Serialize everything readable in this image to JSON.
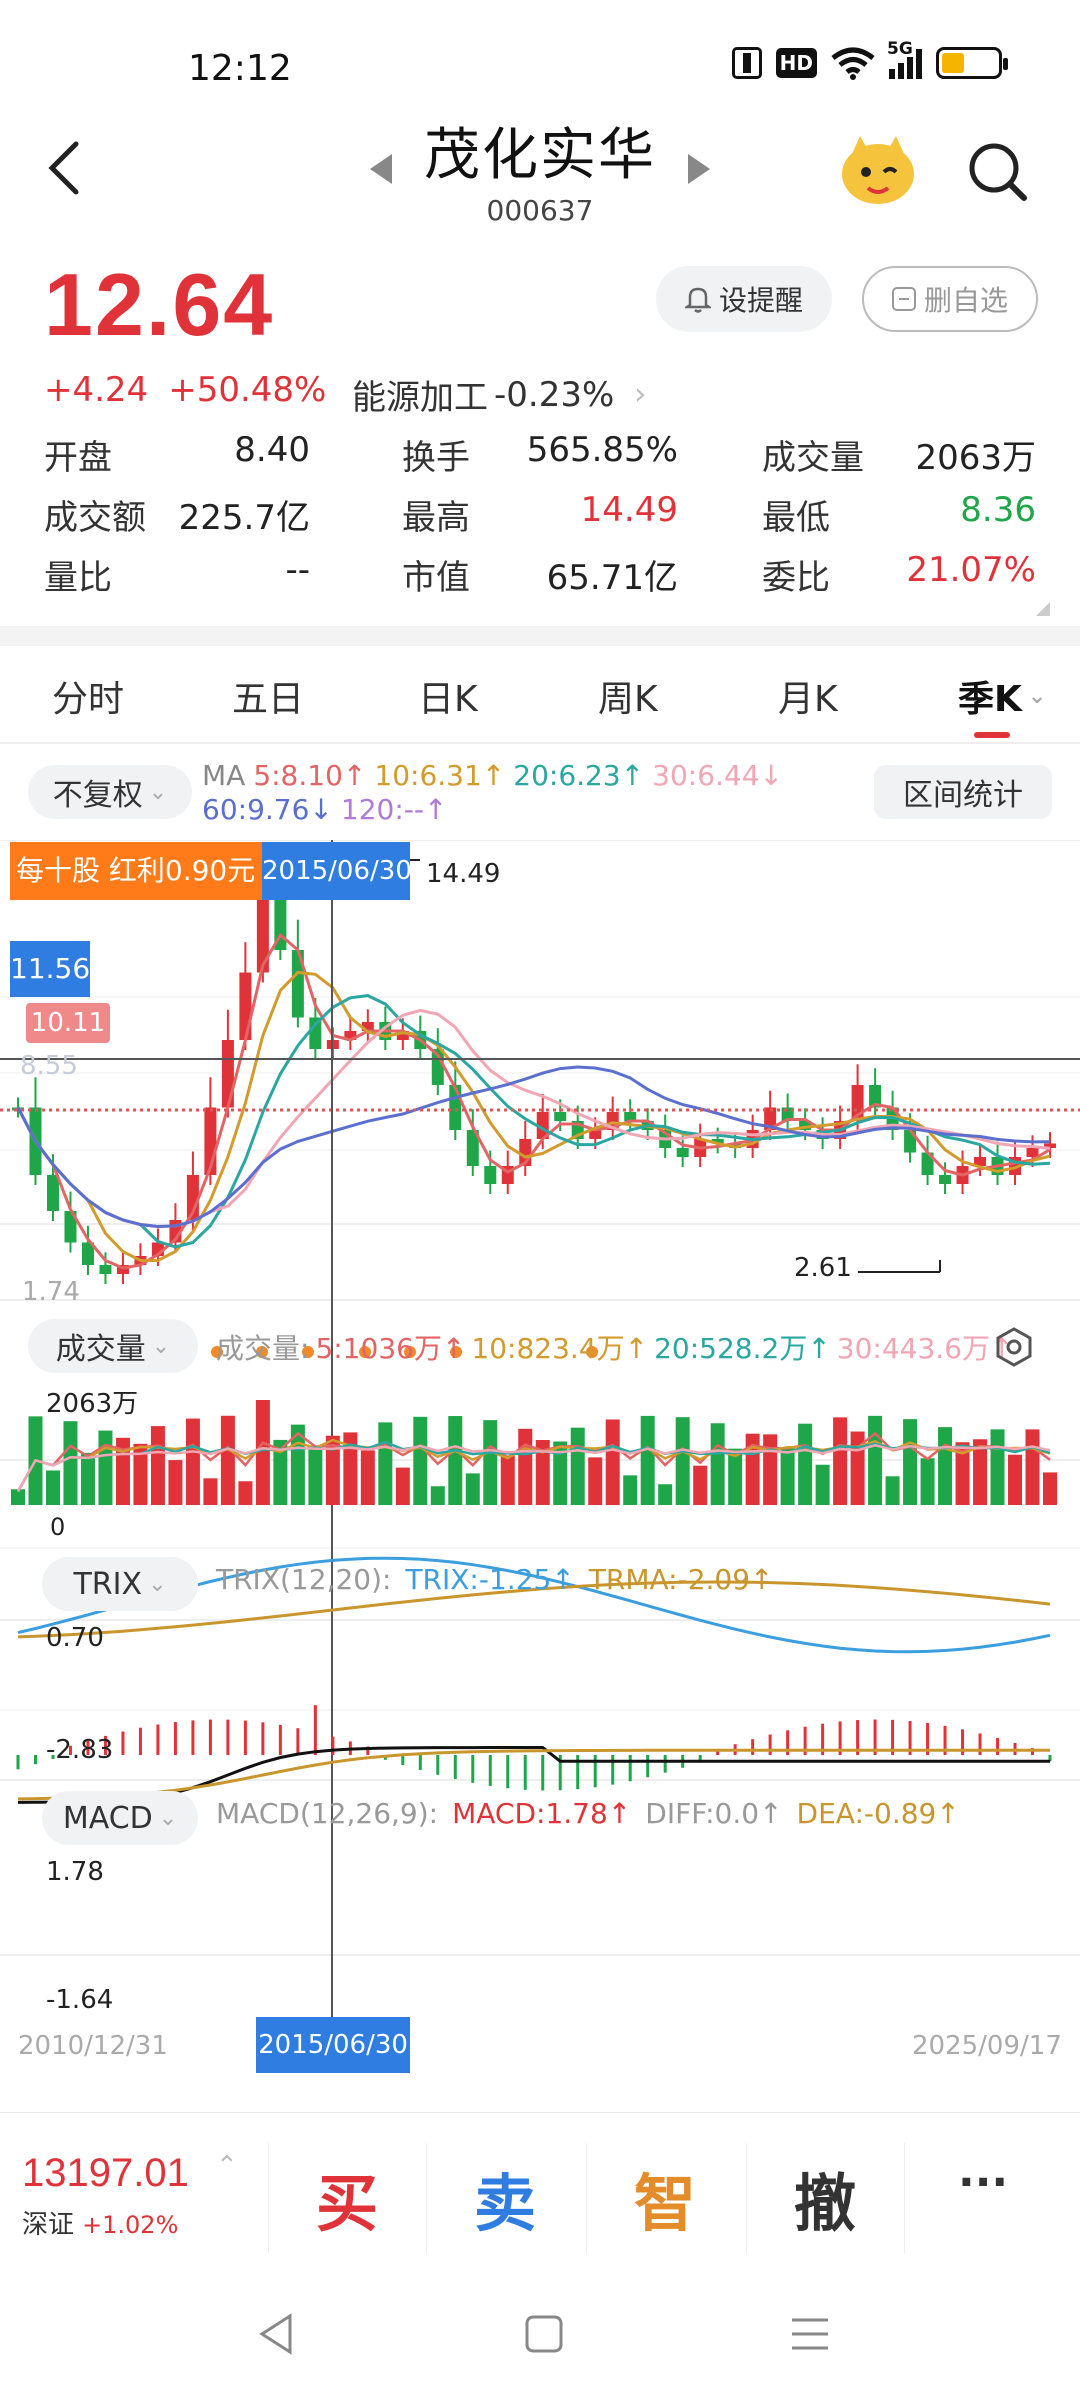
{
  "status_bar": {
    "time": "12:12",
    "nfc_icon": "nfc-icon",
    "hd_label": "HD",
    "network_label": "5G",
    "battery_color": "#f5b400"
  },
  "header": {
    "stock_name": "茂化实华",
    "stock_code": "000637",
    "back_icon": "chevron-left-icon",
    "prev_icon": "triangle-left-icon",
    "next_icon": "triangle-right-icon",
    "mascot_icon": "mascot-icon",
    "search_icon": "search-icon"
  },
  "quote": {
    "price": "12.64",
    "change": "+4.24",
    "change_pct": "+50.48%",
    "sector": "能源加工",
    "sector_change": "-0.23%",
    "alert_label": "设提醒",
    "remove_label": "删自选",
    "stats": [
      [
        {
          "label": "开盘",
          "value": "8.40",
          "color": "#222"
        },
        {
          "label": "换手",
          "value": "565.85%",
          "color": "#222"
        },
        {
          "label": "成交量",
          "value": "2063万",
          "color": "#222"
        }
      ],
      [
        {
          "label": "成交额",
          "value": "225.7亿",
          "color": "#222"
        },
        {
          "label": "最高",
          "value": "14.49",
          "color": "#e03339"
        },
        {
          "label": "最低",
          "value": "8.36",
          "color": "#1ea648"
        }
      ],
      [
        {
          "label": "量比",
          "value": "--",
          "color": "#222"
        },
        {
          "label": "市值",
          "value": "65.71亿",
          "color": "#222"
        },
        {
          "label": "委比",
          "value": "21.07%",
          "color": "#e03339"
        }
      ]
    ]
  },
  "tabs": [
    "分时",
    "五日",
    "日K",
    "周K",
    "月K",
    "季K"
  ],
  "active_tab": 5,
  "chart": {
    "adjust_label": "不复权",
    "range_stats_label": "区间统计",
    "ma_legend": [
      {
        "text": "MA",
        "color": "#888888"
      },
      {
        "text": "5:8.10↑",
        "color": "#e36464"
      },
      {
        "text": "10:6.31↑",
        "color": "#d39a2c"
      },
      {
        "text": "20:6.23↑",
        "color": "#2aa7a0"
      },
      {
        "text": "30:6.44↓",
        "color": "#f2a6b4"
      }
    ],
    "ma_legend2": [
      {
        "text": "60:9.76↓",
        "color": "#5b6fcf"
      },
      {
        "text": "120:--↑",
        "color": "#b07ad8"
      }
    ],
    "dividend_label": "每十股 红利0.90元",
    "crosshair_date": "2015/06/30",
    "high_label": "14.49",
    "crosshair_price": "11.56",
    "dotted_price": "10.11",
    "faded_price": "8.55",
    "min_axis": "1.74",
    "low_label": "2.61",
    "volume_label": "成交量",
    "volume_legend": [
      {
        "text": "成交量:",
        "color": "#999999"
      },
      {
        "text": "5:1036万↑",
        "color": "#e36464"
      },
      {
        "text": "10:823.4万↑",
        "color": "#d39a2c"
      },
      {
        "text": "20:528.2万↑",
        "color": "#2aa7a0"
      },
      {
        "text": "30:443.6万↑",
        "color": "#f2a6b4"
      }
    ],
    "volume_max": "2063万",
    "volume_zero": "0",
    "trix_label": "TRIX",
    "trix_legend": [
      {
        "text": "TRIX(12,20):",
        "color": "#999999"
      },
      {
        "text": "TRIX:-1.25↑",
        "color": "#3b9ede"
      },
      {
        "text": "TRMA:-2.09↑",
        "color": "#c9962e"
      }
    ],
    "trix_max": "0.70",
    "trix_min": "-2.83",
    "macd_label": "MACD",
    "macd_legend": [
      {
        "text": "MACD(12,26,9):",
        "color": "#999999"
      },
      {
        "text": "MACD:1.78↑",
        "color": "#e03339"
      },
      {
        "text": "DIFF:0.0↑",
        "color": "#999999"
      },
      {
        "text": "DEA:-0.89↑",
        "color": "#c9962e"
      }
    ],
    "macd_max": "1.78",
    "macd_min": "-1.64",
    "date_start": "2010/12/31",
    "date_end": "2025/09/17"
  },
  "bottom": {
    "index_value": "13197.01",
    "index_name": "深证",
    "index_change": "+1.02%",
    "buy": "买",
    "sell": "卖",
    "smart": "智",
    "cancel": "撤",
    "more": "···"
  }
}
